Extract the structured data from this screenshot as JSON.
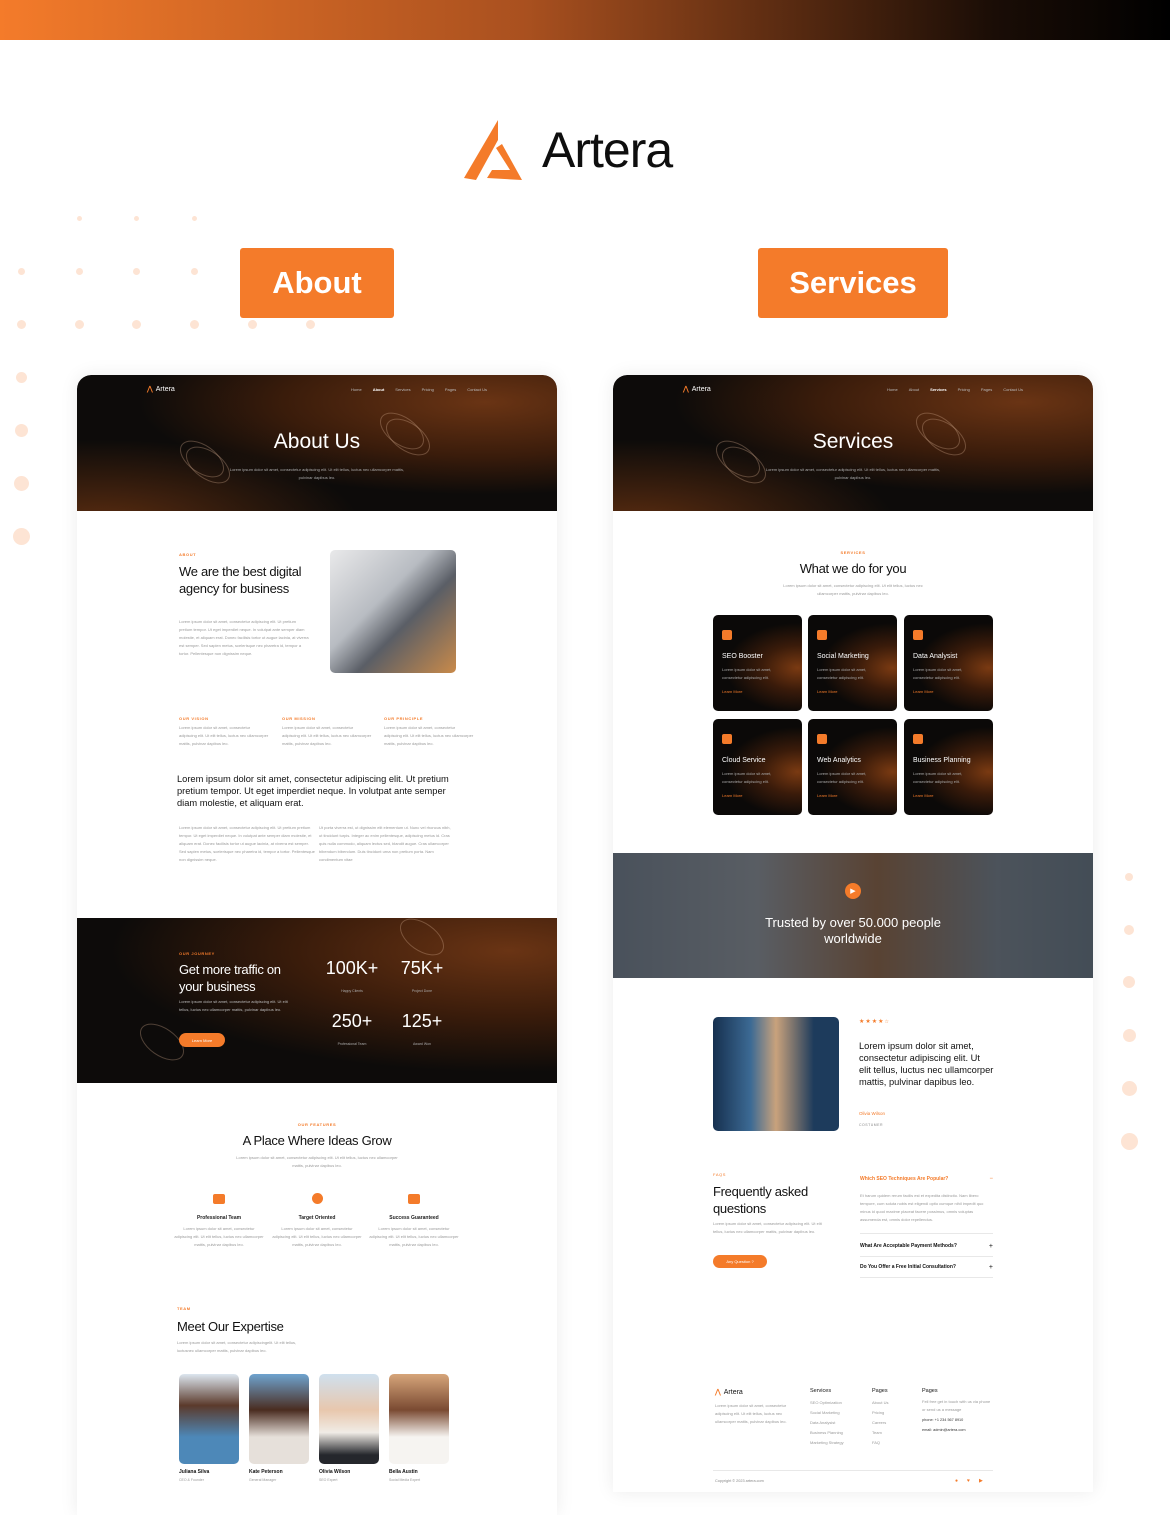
{
  "brand": {
    "name": "Artera",
    "accent": "#f47b2a"
  },
  "labels": {
    "about": "About",
    "services": "Services"
  },
  "nav": {
    "items": [
      "Home",
      "About",
      "Services",
      "Pricing",
      "Pages",
      "Contact Us"
    ],
    "logo": "Artera"
  },
  "about_page": {
    "hero": {
      "title": "About Us",
      "subtitle": "Lorem ipsum dolor sit amet, consectetur adipiscing elit. Ut elit tellus, luctus nec ullamcorper mattis, pulvinar dapibus leo."
    },
    "intro": {
      "label": "ABOUT",
      "heading": "We are the best digital agency for business",
      "body": "Lorem ipsum dolor sit amet, consectetur adipiscing elit. Ut pretium pretium tempor. Ut eget imperdiet neque. In volutpat ante semper diam molestie, et aliquam erat. Donec facilisis tortor ut augue lacinia, at viverra est semper. Sed sapien metus, scelerisque nec pharetra id, tempor a tortor. Pellentesque non dignissim neque."
    },
    "pillars": [
      {
        "label": "OUR VISION",
        "text": "Lorem ipsum dolor sit amet, consectetur adipiscing elit. Ut elit tellus, luctus nec ullamcorper mattis, pulvinar dapibus leo."
      },
      {
        "label": "OUR MISSION",
        "text": "Lorem ipsum dolor sit amet, consectetur adipiscing elit. Ut elit tellus, luctus nec ullamcorper mattis, pulvinar dapibus leo."
      },
      {
        "label": "OUR PRINCIPLE",
        "text": "Lorem ipsum dolor sit amet, consectetur adipiscing elit. Ut elit tellus, luctus nec ullamcorper mattis, pulvinar dapibus leo."
      }
    ],
    "statement": "Lorem ipsum dolor sit amet, consectetur adipiscing elit. Ut pretium pretium tempor. Ut eget imperdiet neque. In volutpat ante semper diam molestie, et aliquam erat.",
    "col1": "Lorem ipsum dolor sit amet, consectetur adipiscing elit. Ut pretium pretium tempor. Ut eget imperdiet neque. In volutpat ante semper diam molestie, et aliquam erat. Donec facilisis tortor ut augue lacinia, at viverra est semper. Sed sapien metus, scelerisque nec pharetra id, tempor a tortor. Pellentesque non dignissim neque.",
    "col2": "Ut porta viverra est, ut dignissim elit elementum ut. Nunc vel rhoncus nibh, ut tincidunt turpis. Integer ac enim pellentesque, adipiscing metus id. Cras quis nulla commodo, aliquam lectus sed, blandit augue. Cras ullamcorper bibendum bibendum. Duis tincidunt urna non pretium porta. Nam condimentum vitae",
    "journey": {
      "label": "OUR JOURNEY",
      "heading": "Get more traffic on your business",
      "body": "Lorem ipsum dolor sit amet, consectetur adipiscing elit. Ut elit tellus, luctus nec ullamcorper mattis, pulvinar dapibus leo.",
      "button": "Learn More",
      "stats": [
        {
          "value": "100K+",
          "label": "Happy Clients"
        },
        {
          "value": "75K+",
          "label": "Project Done"
        },
        {
          "value": "250+",
          "label": "Professional Team"
        },
        {
          "value": "125+",
          "label": "Award Won"
        }
      ]
    },
    "features": {
      "label": "OUR FEATURES",
      "heading": "A Place Where Ideas Grow",
      "body": "Lorem ipsum dolor sit amet, consectetur adipiscing elit. Ut elit tellus, luctus nec ullamcorper mattis, pulvinar dapibus leo.",
      "items": [
        {
          "icon": "briefcase-icon",
          "title": "Professional Team",
          "text": "Lorem ipsum dolor sit amet, consectetur adipiscing elit. Ut elit tellus, luctus nec ullamcorper mattis, pulvinar dapibus leo."
        },
        {
          "icon": "target-icon",
          "title": "Target Oriented",
          "text": "Lorem ipsum dolor sit amet, consectetur adipiscing elit. Ut elit tellus, luctus nec ullamcorper mattis, pulvinar dapibus leo."
        },
        {
          "icon": "thumbs-up-icon",
          "title": "Success Guaranteed",
          "text": "Lorem ipsum dolor sit amet, consectetur adipiscing elit. Ut elit tellus, luctus nec ullamcorper mattis, pulvinar dapibus leo."
        }
      ]
    },
    "team": {
      "label": "TEAM",
      "heading": "Meet Our Expertise",
      "body": "Lorem ipsum dolor sit amet, consectetur adipiscingelit. Ut elit tellus, luctusnec ullamcorper mattis, pulvinar dapibus leo.",
      "members": [
        {
          "name": "Juliana Silva",
          "role": "CEO & Founder"
        },
        {
          "name": "Kate Peterson",
          "role": "General Manager"
        },
        {
          "name": "Olivia Wilson",
          "role": "SEO Expert"
        },
        {
          "name": "Bella Austin",
          "role": "Social Media Expert"
        }
      ]
    }
  },
  "services_page": {
    "hero": {
      "title": "Services",
      "subtitle": "Lorem ipsum dolor sit amet, consectetur adipiscing elit. Ut elit tellus, luctus nec ullamcorper mattis, pulvinar dapibus leo."
    },
    "intro": {
      "label": "SERVICES",
      "heading": "What we do for you",
      "body": "Lorem ipsum dolor sit amet, consectetur adipiscing elit. Ut elit tellus, luctus nec ullamcorper mattis, pulvinar dapibus leo."
    },
    "services": [
      {
        "icon": "rocket-icon",
        "title": "SEO Booster",
        "text": "Lorem ipsum dolor sit amet, consectetur adipiscing elit.",
        "link": "Learn More"
      },
      {
        "icon": "monitor-chart-icon",
        "title": "Social Marketing",
        "text": "Lorem ipsum dolor sit amet, consectetur adipiscing elit.",
        "link": "Learn More"
      },
      {
        "icon": "bar-chart-icon",
        "title": "Data Analysist",
        "text": "Lorem ipsum dolor sit amet, consectetur adipiscing elit.",
        "link": "Learn More"
      },
      {
        "icon": "server-icon",
        "title": "Cloud Service",
        "text": "Lorem ipsum dolor sit amet, consectetur adipiscing elit.",
        "link": "Learn More"
      },
      {
        "icon": "laptop-analytics-icon",
        "title": "Web Analytics",
        "text": "Lorem ipsum dolor sit amet, consectetur adipiscing elit.",
        "link": "Learn More"
      },
      {
        "icon": "clipboard-gear-icon",
        "title": "Business Planning",
        "text": "Lorem ipsum dolor sit amet, consectetur adipiscing elit.",
        "link": "Learn More"
      }
    ],
    "trust": "Trusted by over 50.000 people worldwide",
    "testimonial": {
      "rating": 4,
      "max": 5,
      "quote": "Lorem ipsum dolor sit amet, consectetur adipiscing elit. Ut elit tellus, luctus nec ullamcorper mattis, pulvinar dapibus leo.",
      "name": "Olivia Wilson",
      "role": "COSTUMER"
    },
    "faq": {
      "label": "FAQS",
      "heading": "Frequently asked questions",
      "body": "Lorem ipsum dolor sit amet, consectetur adipiscing elit. Ut elit tellus, luctus nec ullamcorper mattis, pulvinar dapibus leo.",
      "button": "Any Question ?",
      "items": [
        {
          "q": "Which SEO Techniques Are Popular?",
          "a": "Et harum quidem rerum facilis est et expedita distinctio. Nam libero tempore, cum soluta nobis est eligendi optio cumque nihil impedit quo minus id quod maxime placeat facere possimus, omnis voluptas assumenda est, omnis dolor repellendus.",
          "open": true
        },
        {
          "q": "What Are Acceptable Payment Methods?",
          "open": false
        },
        {
          "q": "Do You Offer a Free Initial Consultation?",
          "open": false
        }
      ]
    },
    "footer": {
      "logo": "Artera",
      "about": "Lorem ipsum dolor sit amet, consectetur adipiscing elit. Ut elit tellus, luctus nec ullamcorper mattis, pulvinar dapibus leo.",
      "col1": {
        "title": "Services",
        "links": [
          "SEO Optimization",
          "Social Marketing",
          "Data Analysist",
          "Business Planning",
          "Marketing Strategy"
        ]
      },
      "col2": {
        "title": "Pages",
        "links": [
          "About Us",
          "Pricing",
          "Careers",
          "Team",
          "FAQ"
        ]
      },
      "col3": {
        "title": "Pages",
        "text": "Fell free get in touch with us via phone or send us a message",
        "phone": "phone: +1 234 567 8910",
        "email": "email: admin@artera.com"
      },
      "copyright": "Copyright © 2023 artera.com",
      "social": [
        "facebook-icon",
        "twitter-icon",
        "youtube-icon"
      ]
    }
  }
}
